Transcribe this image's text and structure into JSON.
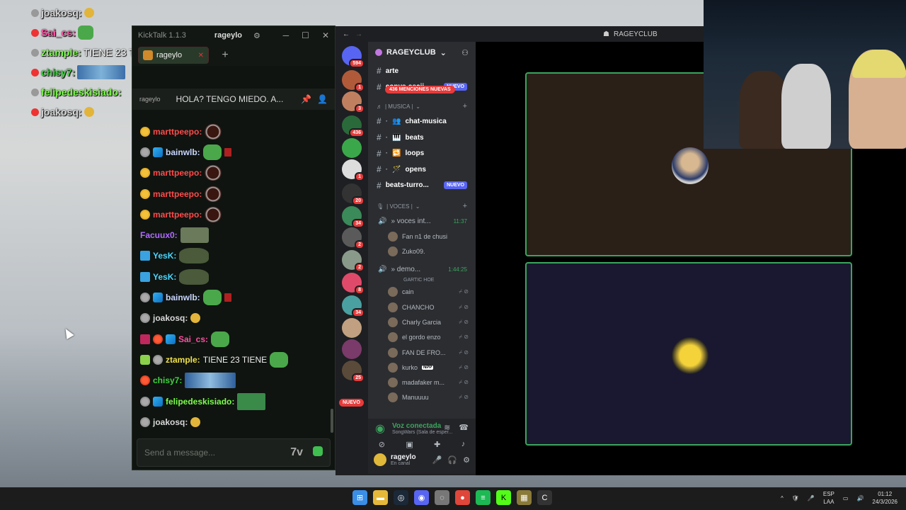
{
  "overlay": {
    "lines": [
      {
        "user": "joakosq:",
        "color": "#d8d8d8",
        "msg": "",
        "emote": "small"
      },
      {
        "user": "Sai_cs:",
        "color": "#ff4fa0",
        "msg": "",
        "emote": "pepe"
      },
      {
        "user": "ztample:",
        "color": "#7cff4a",
        "msg": "TIENE 23 TIENE",
        "emote": "pepe"
      },
      {
        "user": "chisy7:",
        "color": "#3ed43e",
        "msg": "",
        "emote": "bus"
      },
      {
        "user": "felipedeskisiado:",
        "color": "#7cff4a",
        "msg": "",
        "emote": ""
      },
      {
        "user": "joakosq:",
        "color": "#d8d8d8",
        "msg": "",
        "emote": "small"
      }
    ]
  },
  "kicktalk": {
    "app_title": "KickTalk 1.1.3",
    "username": "rageylo",
    "tab_label": "rageylo",
    "add_tab": "+",
    "pinned_prefix": "rageylo",
    "pinned_message": "HOLA? TENGO MIEDO. A...",
    "input_placeholder": "Send a message...",
    "messages": [
      {
        "user": "marttpeepo:",
        "color": "#ff4a4a",
        "msg": "",
        "badges": [
          "b-sub"
        ],
        "emotes": [
          "e-ring"
        ]
      },
      {
        "user": "bainwlb:",
        "color": "#c9d6ff",
        "msg": "",
        "badges": [
          "b-gray",
          "b-blue"
        ],
        "emotes": [
          "e-pepe",
          "e-tiny"
        ]
      },
      {
        "user": "marttpeepo:",
        "color": "#ff4a4a",
        "msg": "",
        "badges": [
          "b-sub"
        ],
        "emotes": [
          "e-ring"
        ]
      },
      {
        "user": "marttpeepo:",
        "color": "#ff4a4a",
        "msg": "",
        "badges": [
          "b-sub"
        ],
        "emotes": [
          "e-ring"
        ]
      },
      {
        "user": "marttpeepo:",
        "color": "#ff4a4a",
        "msg": "",
        "badges": [
          "b-sub"
        ],
        "emotes": [
          "e-ring"
        ]
      },
      {
        "user": "Facuux0:",
        "color": "#b06cff",
        "msg": "",
        "badges": [],
        "emotes": [
          "e-face"
        ]
      },
      {
        "user": "YesK:",
        "color": "#4ad6ff",
        "msg": "",
        "badges": [
          "b-tool"
        ],
        "emotes": [
          "e-frog"
        ]
      },
      {
        "user": "YesK:",
        "color": "#4ad6ff",
        "msg": "",
        "badges": [
          "b-tool"
        ],
        "emotes": [
          "e-frog"
        ]
      },
      {
        "user": "bainwlb:",
        "color": "#c9d6ff",
        "msg": "",
        "badges": [
          "b-gray",
          "b-blue"
        ],
        "emotes": [
          "e-pepe",
          "e-tiny"
        ]
      },
      {
        "user": "joakosq:",
        "color": "#d8d8d8",
        "msg": "",
        "badges": [
          "b-gray"
        ],
        "emotes": [
          "e-small"
        ]
      },
      {
        "user": "Sai_cs:",
        "color": "#ff4fa0",
        "msg": "",
        "badges": [
          "b-pink",
          "b-red",
          "b-blue"
        ],
        "emotes": [
          "e-pepe"
        ]
      },
      {
        "user": "ztample:",
        "color": "#f0e04a",
        "msg": "TIENE 23 TIENE",
        "badges": [
          "b-green",
          "b-gray"
        ],
        "emotes": [
          "e-pepe"
        ]
      },
      {
        "user": "chisy7:",
        "color": "#3ed43e",
        "msg": "",
        "badges": [
          "b-red"
        ],
        "emotes": [
          "e-bus"
        ]
      },
      {
        "user": "felipedeskisiado:",
        "color": "#7cff4a",
        "msg": "",
        "badges": [
          "b-gray",
          "b-blue"
        ],
        "emotes": [
          "e-pic"
        ]
      },
      {
        "user": "joakosq:",
        "color": "#d8d8d8",
        "msg": "",
        "badges": [
          "b-gray"
        ],
        "emotes": [
          "e-small"
        ]
      }
    ]
  },
  "discord": {
    "window_title": "RAGEYCLUB",
    "server_name": "RAGEYCLUB",
    "mentions": "436 MENCIONES NUEVAS",
    "rail_badges": [
      "594",
      "1",
      "3",
      "436",
      "1",
      "20",
      "34",
      "2",
      "2",
      "8",
      "34",
      "25"
    ],
    "rail_new": "NUEVO",
    "channels_top": [
      {
        "name": "arte",
        "prefix": "# · ",
        "bold": true,
        "new": false
      },
      {
        "name": "copys-ascii",
        "prefix": "# ",
        "bold": true,
        "new": true
      }
    ],
    "music_category": "| MUSICA |",
    "music_channels": [
      "chat-musica",
      "beats",
      "loops",
      "opens"
    ],
    "beats_channel": "beats-turro...",
    "new_label": "NUEVO",
    "voces_category": "| VOCES |",
    "vc1": {
      "name": "» voces int...",
      "time": "11:37"
    },
    "vc1_members": [
      "Fan n1 de chusi",
      "Zuko09."
    ],
    "vc2": {
      "name": "» demo...",
      "time": "1:44:25",
      "sub": "GARTIC HOE"
    },
    "vc2_members": [
      "cain",
      "CHANCHO",
      "Charly Garcia",
      "el gordo enzo",
      "FAN DE FRO...",
      "kurko",
      "madafaker m...",
      "Manuuuu"
    ],
    "npp": "NPP",
    "voice_status": "Voz conectada",
    "voice_channel": "SongWars (Sala de esper...",
    "user_name": "rageylo",
    "user_status": "En canal"
  },
  "taskbar": {
    "lang_top": "ESP",
    "lang_bottom": "LAA",
    "time": "01:12",
    "date": "24/3/2026"
  }
}
